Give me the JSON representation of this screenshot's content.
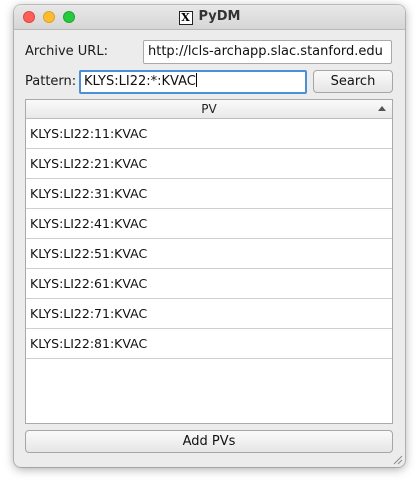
{
  "window": {
    "title": "PyDM",
    "title_icon": "x11-icon"
  },
  "form": {
    "archive_url_label": "Archive URL:",
    "archive_url_value": "http://lcls-archapp.slac.stanford.edu",
    "pattern_label": "Pattern:",
    "pattern_value": "KLYS:LI22:*:KVAC",
    "search_button": "Search"
  },
  "table": {
    "header": "PV",
    "sort_indicator": "ascending",
    "rows": [
      "KLYS:LI22:11:KVAC",
      "KLYS:LI22:21:KVAC",
      "KLYS:LI22:31:KVAC",
      "KLYS:LI22:41:KVAC",
      "KLYS:LI22:51:KVAC",
      "KLYS:LI22:61:KVAC",
      "KLYS:LI22:71:KVAC",
      "KLYS:LI22:81:KVAC"
    ]
  },
  "footer": {
    "add_pvs_button": "Add PVs"
  },
  "colors": {
    "focus": "#4a8fd8",
    "close": "#fe5f57",
    "minimize": "#febc2e",
    "maximize": "#28c840"
  }
}
